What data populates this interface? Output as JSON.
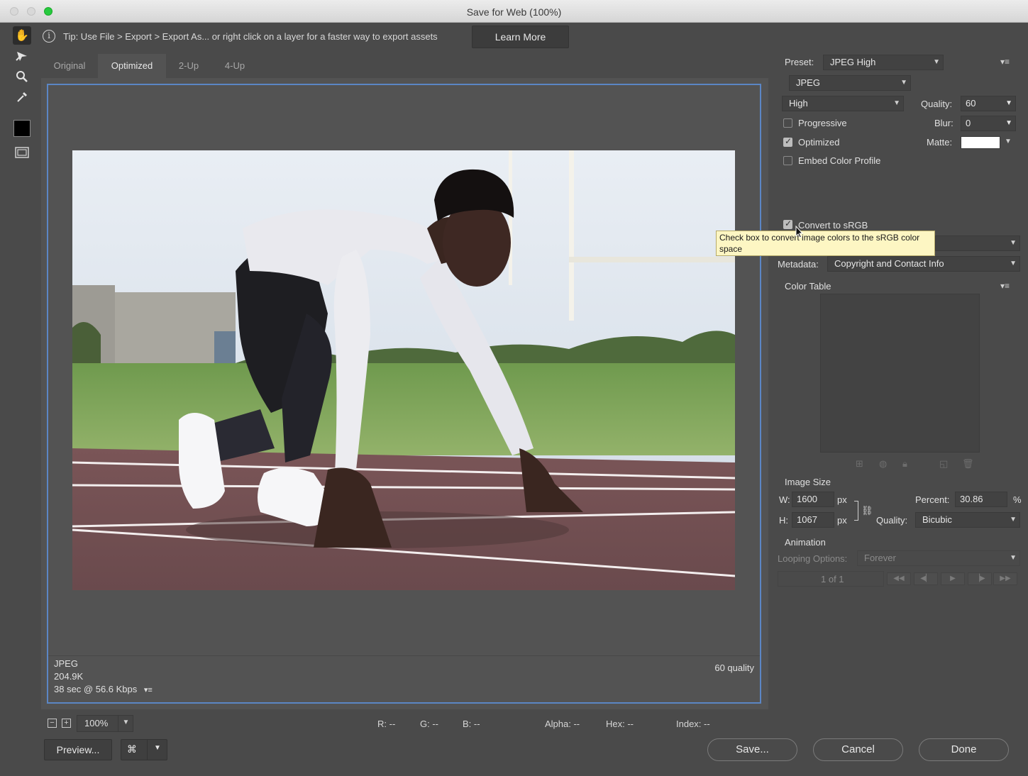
{
  "window": {
    "title": "Save for Web (100%)"
  },
  "tip": {
    "text": "Tip: Use File > Export > Export As...  or right click on a layer for a faster way to export assets",
    "learn_more": "Learn More"
  },
  "tabs": [
    {
      "label": "Original",
      "active": false
    },
    {
      "label": "Optimized",
      "active": true
    },
    {
      "label": "2-Up",
      "active": false
    },
    {
      "label": "4-Up",
      "active": false
    }
  ],
  "image_info": {
    "format": "JPEG",
    "size": "204.9K",
    "download_time": "38 sec @ 56.6 Kbps",
    "quality_note": "60 quality"
  },
  "status": {
    "zoom": "100%",
    "r": "R: --",
    "g": "G: --",
    "b": "B: --",
    "alpha": "Alpha: --",
    "hex": "Hex: --",
    "index": "Index: --"
  },
  "buttons": {
    "preview": "Preview...",
    "save": "Save...",
    "cancel": "Cancel",
    "done": "Done"
  },
  "settings": {
    "preset_label": "Preset:",
    "preset_value": "JPEG High",
    "format_value": "JPEG",
    "compression_value": "High",
    "quality_label": "Quality:",
    "quality_value": "60",
    "blur_label": "Blur:",
    "blur_value": "0",
    "matte_label": "Matte:",
    "matte_color": "#ffffff",
    "progressive": {
      "label": "Progressive",
      "checked": false
    },
    "optimized": {
      "label": "Optimized",
      "checked": true
    },
    "embed_color_profile": {
      "label": "Embed Color Profile",
      "checked": false
    },
    "convert_srgb": {
      "label": "Convert to sRGB",
      "checked": true
    },
    "metadata_label": "Metadata:",
    "metadata_value": "Copyright and Contact Info",
    "color_table_label": "Color Table"
  },
  "tooltip": {
    "text": "Check box to convert image colors to the sRGB color space"
  },
  "image_size": {
    "heading": "Image Size",
    "w_label": "W:",
    "w_value": "1600",
    "h_label": "H:",
    "h_value": "1067",
    "unit": "px",
    "percent_label": "Percent:",
    "percent_value": "30.86",
    "percent_unit": "%",
    "quality_label": "Quality:",
    "quality_value": "Bicubic"
  },
  "animation": {
    "heading": "Animation",
    "looping_label": "Looping Options:",
    "looping_value": "Forever",
    "frame_counter": "1 of 1"
  },
  "colors": {
    "canvas_border": "#5b86c4",
    "panel_bg": "#4a4a4a",
    "tooltip_bg": "#fdf6c3"
  }
}
